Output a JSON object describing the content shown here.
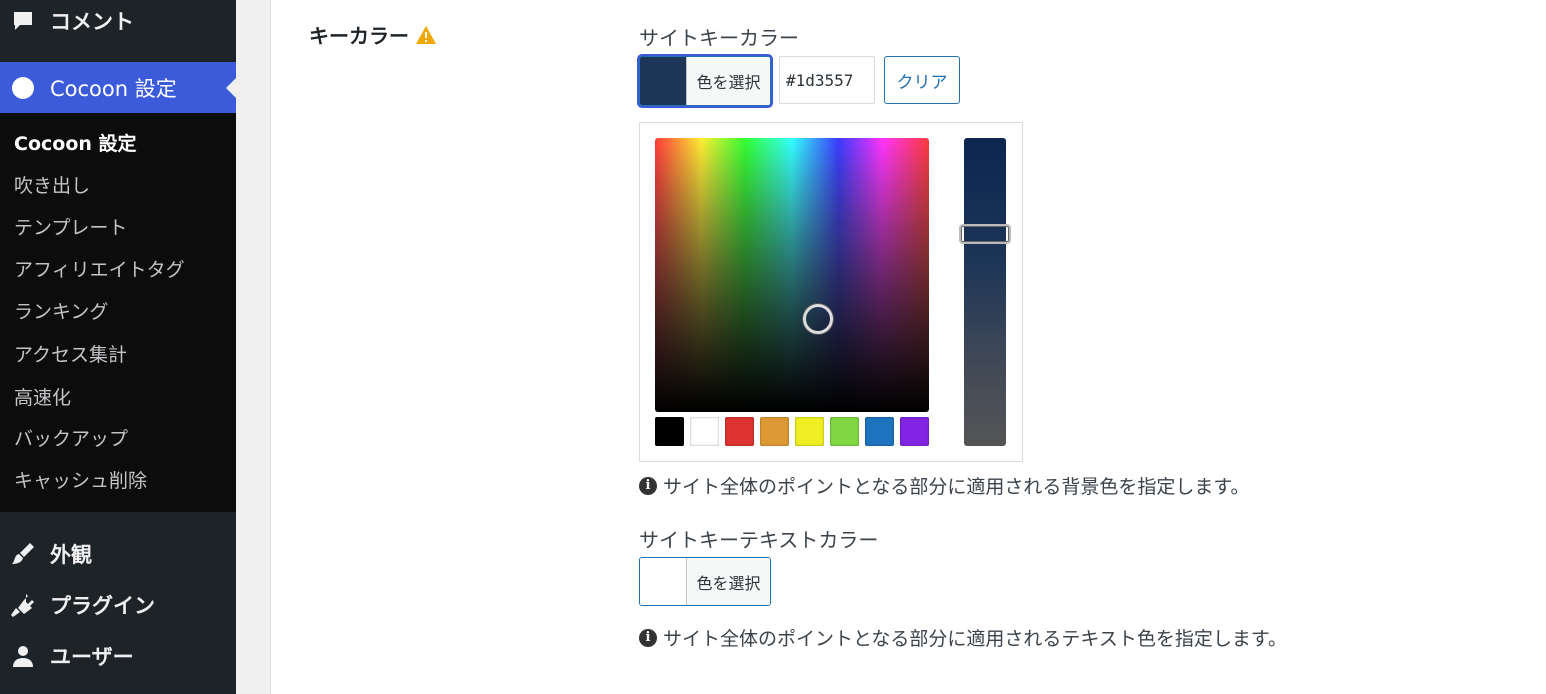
{
  "sidebar": {
    "comment": {
      "label": "コメント",
      "icon": "comment-icon"
    },
    "current": {
      "label": "Cocoon 設定",
      "icon": "cocoon-icon"
    },
    "submenu": [
      {
        "label": "Cocoon 設定",
        "active": true
      },
      {
        "label": "吹き出し"
      },
      {
        "label": "テンプレート"
      },
      {
        "label": "アフィリエイトタグ"
      },
      {
        "label": "ランキング"
      },
      {
        "label": "アクセス集計"
      },
      {
        "label": "高速化"
      },
      {
        "label": "バックアップ"
      },
      {
        "label": "キャッシュ削除"
      }
    ],
    "appearance": {
      "label": "外観",
      "icon": "paintbrush-icon"
    },
    "plugins": {
      "label": "プラグイン",
      "icon": "plugin-icon"
    },
    "users": {
      "label": "ユーザー",
      "icon": "user-icon"
    }
  },
  "main": {
    "field_label": "キーカラー",
    "site_key_color": {
      "label": "サイトキーカラー",
      "button_label": "色を選択",
      "swatch_color": "#1d3557",
      "hex_value": "#1d3557",
      "clear_label": "クリア",
      "description": "サイト全体のポイントとなる部分に適用される背景色を指定します。",
      "palette": [
        "#000000",
        "#ffffff",
        "#dd3333",
        "#dd9933",
        "#eeee22",
        "#81d742",
        "#1e73be",
        "#8224e3"
      ]
    },
    "site_key_text_color": {
      "label": "サイトキーテキストカラー",
      "button_label": "色を選択",
      "swatch_color": "#ffffff",
      "description": "サイト全体のポイントとなる部分に適用されるテキスト色を指定します。"
    }
  },
  "colors": {
    "accent": "#3b5bdb",
    "sidebar_bg": "#1d2327",
    "link": "#2271b1"
  }
}
